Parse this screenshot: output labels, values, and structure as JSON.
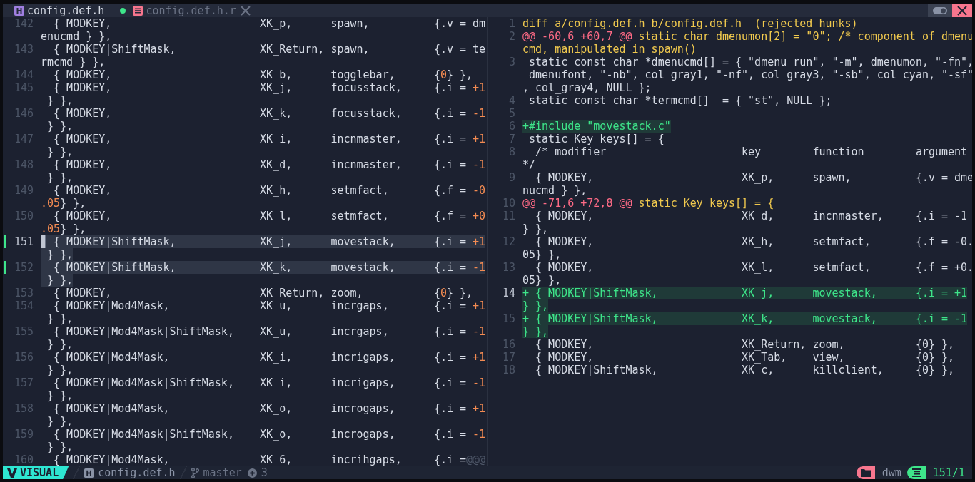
{
  "tabs": [
    {
      "label": "config.def.h",
      "kind": "header",
      "selected": true,
      "modified": true
    },
    {
      "label": "config.def.h.r",
      "kind": "text",
      "selected": false,
      "modified": false
    }
  ],
  "left": {
    "lines": [
      {
        "number": "142",
        "selected": false,
        "changed": false,
        "current": false,
        "rows": [
          "  { MODKEY,                       XK_p,      spawn,          {.v = dm",
          "enucmd } },"
        ]
      },
      {
        "number": "143",
        "selected": false,
        "changed": false,
        "current": false,
        "rows": [
          "  { MODKEY|ShiftMask,             XK_Return, spawn,          {.v = te",
          "rmcmd } },"
        ]
      },
      {
        "number": "144",
        "selected": false,
        "changed": false,
        "current": false,
        "rows": [
          {
            "parts": [
              {
                "text": "  { MODKEY,                       XK_b,      togglebar,      {",
                "kind": "code"
              },
              {
                "text": "0",
                "kind": "num"
              },
              {
                "text": "} },",
                "kind": "code"
              }
            ]
          }
        ]
      },
      {
        "number": "145",
        "selected": false,
        "changed": false,
        "current": false,
        "rows": [
          {
            "parts": [
              {
                "text": "  { MODKEY,                       XK_j,      focusstack,     {.i = ",
                "kind": "code"
              },
              {
                "text": "+1",
                "kind": "num"
              }
            ]
          },
          " } },"
        ]
      },
      {
        "number": "146",
        "selected": false,
        "changed": false,
        "current": false,
        "rows": [
          {
            "parts": [
              {
                "text": "  { MODKEY,                       XK_k,      focusstack,     {.i = ",
                "kind": "code"
              },
              {
                "text": "-1",
                "kind": "num"
              }
            ]
          },
          " } },"
        ]
      },
      {
        "number": "147",
        "selected": false,
        "changed": false,
        "current": false,
        "rows": [
          {
            "parts": [
              {
                "text": "  { MODKEY,                       XK_i,      incnmaster,     {.i = ",
                "kind": "code"
              },
              {
                "text": "+1",
                "kind": "num"
              }
            ]
          },
          " } },"
        ]
      },
      {
        "number": "148",
        "selected": false,
        "changed": false,
        "current": false,
        "rows": [
          {
            "parts": [
              {
                "text": "  { MODKEY,                       XK_d,      incnmaster,     {.i = ",
                "kind": "code"
              },
              {
                "text": "-1",
                "kind": "num"
              }
            ]
          },
          " } },"
        ]
      },
      {
        "number": "149",
        "selected": false,
        "changed": false,
        "current": false,
        "rows": [
          {
            "parts": [
              {
                "text": "  { MODKEY,                       XK_h,      setmfact,       {.f = ",
                "kind": "code"
              },
              {
                "text": "-0",
                "kind": "num"
              }
            ]
          },
          {
            "parts": [
              {
                "text": ".05",
                "kind": "num"
              },
              {
                "text": "} },",
                "kind": "code"
              }
            ]
          }
        ]
      },
      {
        "number": "150",
        "selected": false,
        "changed": false,
        "current": false,
        "rows": [
          {
            "parts": [
              {
                "text": "  { MODKEY,                       XK_l,      setmfact,       {.f = ",
                "kind": "code"
              },
              {
                "text": "+0",
                "kind": "num"
              }
            ]
          },
          {
            "parts": [
              {
                "text": ".05",
                "kind": "num"
              },
              {
                "text": "} },",
                "kind": "code"
              }
            ]
          }
        ]
      },
      {
        "number": "151",
        "selected": true,
        "changed": true,
        "current": true,
        "rows": [
          {
            "parts": [
              {
                "text": "  { MODKEY|ShiftMask,             XK_j,      movestack,      {.i = ",
                "kind": "code"
              },
              {
                "text": "+1",
                "kind": "num"
              }
            ]
          },
          " } },"
        ]
      },
      {
        "number": "152",
        "selected": true,
        "changed": true,
        "current": false,
        "rows": [
          {
            "parts": [
              {
                "text": "  { MODKEY|ShiftMask,             XK_k,      movestack,      {.i = ",
                "kind": "code"
              },
              {
                "text": "-1",
                "kind": "num"
              }
            ]
          },
          " } },"
        ]
      },
      {
        "number": "153",
        "selected": false,
        "changed": false,
        "current": false,
        "rows": [
          {
            "parts": [
              {
                "text": "  { MODKEY,                       XK_Return, zoom,           {",
                "kind": "code"
              },
              {
                "text": "0",
                "kind": "num"
              },
              {
                "text": "} },",
                "kind": "code"
              }
            ]
          }
        ]
      },
      {
        "number": "154",
        "selected": false,
        "changed": false,
        "current": false,
        "rows": [
          {
            "parts": [
              {
                "text": "  { MODKEY|Mod4Mask,              XK_u,      incrgaps,       {.i = ",
                "kind": "code"
              },
              {
                "text": "+1",
                "kind": "num"
              }
            ]
          },
          " } },"
        ]
      },
      {
        "number": "155",
        "selected": false,
        "changed": false,
        "current": false,
        "rows": [
          {
            "parts": [
              {
                "text": "  { MODKEY|Mod4Mask|ShiftMask,    XK_u,      incrgaps,       {.i = ",
                "kind": "code"
              },
              {
                "text": "-1",
                "kind": "num"
              }
            ]
          },
          " } },"
        ]
      },
      {
        "number": "156",
        "selected": false,
        "changed": false,
        "current": false,
        "rows": [
          {
            "parts": [
              {
                "text": "  { MODKEY|Mod4Mask,              XK_i,      incrigaps,      {.i = ",
                "kind": "code"
              },
              {
                "text": "+1",
                "kind": "num"
              }
            ]
          },
          " } },"
        ]
      },
      {
        "number": "157",
        "selected": false,
        "changed": false,
        "current": false,
        "rows": [
          {
            "parts": [
              {
                "text": "  { MODKEY|Mod4Mask|ShiftMask,    XK_i,      incrigaps,      {.i = ",
                "kind": "code"
              },
              {
                "text": "-1",
                "kind": "num"
              }
            ]
          },
          " } },"
        ]
      },
      {
        "number": "158",
        "selected": false,
        "changed": false,
        "current": false,
        "rows": [
          {
            "parts": [
              {
                "text": "  { MODKEY|Mod4Mask,              XK_o,      incrogaps,      {.i = ",
                "kind": "code"
              },
              {
                "text": "+1",
                "kind": "num"
              }
            ]
          },
          " } },"
        ]
      },
      {
        "number": "159",
        "selected": false,
        "changed": false,
        "current": false,
        "rows": [
          {
            "parts": [
              {
                "text": "  { MODKEY|Mod4Mask|ShiftMask,    XK_o,      incrogaps,      {.i = ",
                "kind": "code"
              },
              {
                "text": "-1",
                "kind": "num"
              }
            ]
          },
          " } },"
        ]
      },
      {
        "number": "160",
        "selected": false,
        "changed": false,
        "current": false,
        "rows": [
          {
            "parts": [
              {
                "text": "  { MODKEY|Mod4Mask,              XK_6,      incrihgaps,     {.i =",
                "kind": "code"
              },
              {
                "text": "@@@",
                "kind": "more"
              }
            ]
          }
        ]
      }
    ]
  },
  "right": {
    "lines": [
      {
        "number": "1",
        "kind": "meta",
        "current": false,
        "rows": [
          "diff a/config.def.h b/config.def.h  (rejected hunks)"
        ]
      },
      {
        "number": "2",
        "kind": "hunk",
        "current": false,
        "rows": [
          {
            "parts": [
              {
                "text": "@@ -60,6 +60,7 @@",
                "kind": "hunk"
              },
              {
                "text": " static char dmenumon[2] = \"0\"; /* component of dmenu",
                "kind": "meta"
              }
            ]
          },
          {
            "parts": [
              {
                "text": "cmd, manipulated in spawn()",
                "kind": "meta"
              }
            ]
          }
        ]
      },
      {
        "number": "3",
        "kind": "context",
        "current": false,
        "rows": [
          " static const char *dmenucmd[] = { \"dmenu_run\", \"-m\", dmenumon, \"-fn\",",
          " dmenufont, \"-nb\", col_gray1, \"-nf\", col_gray3, \"-sb\", col_cyan, \"-sf\"",
          ", col_gray4, NULL };"
        ]
      },
      {
        "number": "4",
        "kind": "context",
        "current": false,
        "rows": [
          " static const char *termcmd[]  = { \"st\", NULL };"
        ]
      },
      {
        "number": "5",
        "current": false
      },
      {
        "number": "6",
        "kind": "added",
        "current": false,
        "rows": [
          "+#include \"movestack.c\""
        ]
      },
      {
        "number": "7",
        "kind": "context",
        "current": false,
        "rows": [
          " static Key keys[] = {"
        ]
      },
      {
        "number": "8",
        "kind": "context",
        "current": false,
        "rows": [
          "  /* modifier                     key        function        argument",
          "*/"
        ]
      },
      {
        "number": "9",
        "kind": "context",
        "current": false,
        "rows": [
          "  { MODKEY,                       XK_p,      spawn,          {.v = dme",
          "nucmd } },"
        ]
      },
      {
        "number": "10",
        "kind": "hunk",
        "current": false,
        "rows": [
          {
            "parts": [
              {
                "text": "@@ -71,6 +72,8 @@",
                "kind": "hunk"
              },
              {
                "text": " static Key keys[] = {",
                "kind": "meta"
              }
            ]
          }
        ]
      },
      {
        "number": "11",
        "kind": "context",
        "current": false,
        "rows": [
          "  { MODKEY,                       XK_d,      incnmaster,     {.i = -1",
          "} },"
        ]
      },
      {
        "number": "12",
        "kind": "context",
        "current": false,
        "rows": [
          "  { MODKEY,                       XK_h,      setmfact,       {.f = -0.",
          "05} },"
        ]
      },
      {
        "number": "13",
        "kind": "context",
        "current": false,
        "rows": [
          "  { MODKEY,                       XK_l,      setmfact,       {.f = +0.",
          "05} },"
        ]
      },
      {
        "number": "14",
        "kind": "added",
        "current": true,
        "rows": [
          "+ { MODKEY|ShiftMask,             XK_j,      movestack,      {.i = +1",
          "} },"
        ]
      },
      {
        "number": "15",
        "kind": "added",
        "current": false,
        "rows": [
          "+ { MODKEY|ShiftMask,             XK_k,      movestack,      {.i = -1",
          "} },"
        ]
      },
      {
        "number": "16",
        "kind": "context",
        "current": false,
        "rows": [
          "  { MODKEY,                       XK_Return, zoom,           {0} },"
        ]
      },
      {
        "number": "17",
        "kind": "context",
        "current": false,
        "rows": [
          "  { MODKEY,                       XK_Tab,    view,           {0} },"
        ]
      },
      {
        "number": "18",
        "kind": "context",
        "current": false,
        "rows": [
          "  { MODKEY|ShiftMask,             XK_c,      killclient,     {0} },"
        ]
      }
    ]
  },
  "status": {
    "mode": "VISUAL",
    "file": "config.def.h",
    "branch": "master",
    "added": "3",
    "project": "dwm",
    "position": "151/1"
  }
}
